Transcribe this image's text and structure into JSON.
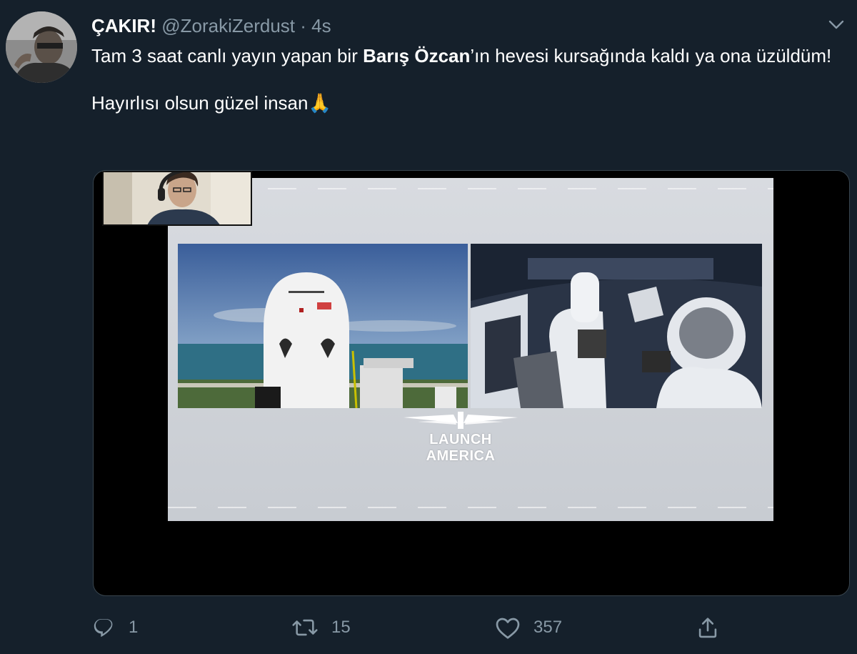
{
  "tweet": {
    "display_name": "ÇAKIR!",
    "handle": "@ZorakiZerdust",
    "separator": "·",
    "time": "4s",
    "text": {
      "part1": "Tam 3 saat canlı yayın yapan bir ",
      "bold_name": "Barış Özcan",
      "part2": "’ın hevesi kursağında kaldı ya ona üzüldüm!",
      "line2": "Hayırlısı olsun güzel insan",
      "emoji": "🙏"
    }
  },
  "media": {
    "logo_text": "LAUNCH AMERICA"
  },
  "actions": {
    "reply_count": "1",
    "retweet_count": "15",
    "like_count": "357"
  },
  "icons": {
    "more": "chevron-down-icon",
    "reply": "reply-icon",
    "retweet": "retweet-icon",
    "like": "heart-icon",
    "share": "share-icon"
  },
  "colors": {
    "background": "#15202b",
    "text": "#ffffff",
    "secondary": "#8899a6"
  }
}
